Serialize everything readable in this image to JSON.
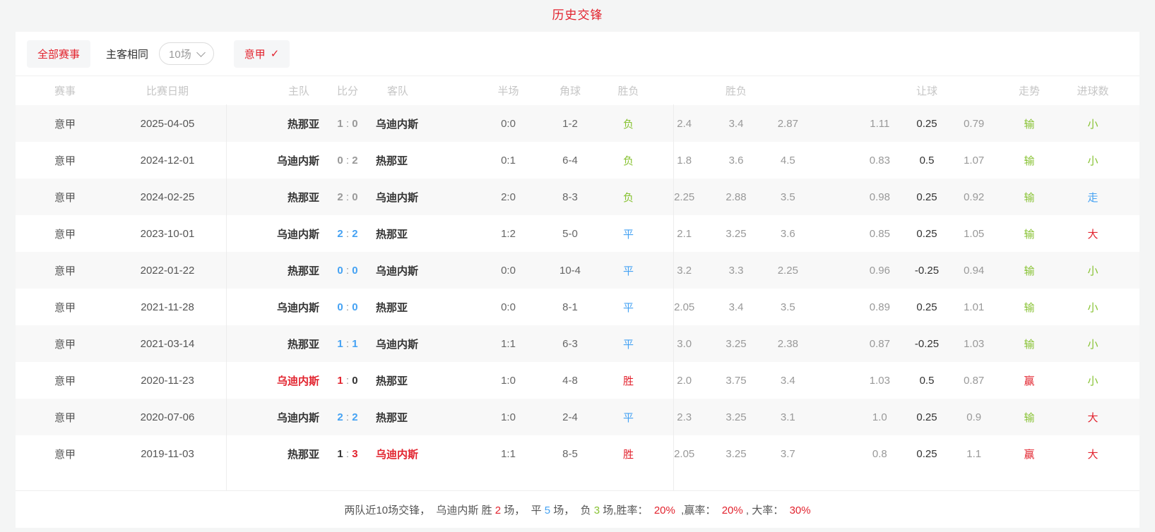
{
  "page": {
    "title": "历史交锋"
  },
  "colors": {
    "accent_red": "#e2232e",
    "win_red": "#e2232e",
    "draw_blue": "#45a2f3",
    "loss_green": "#87c232"
  },
  "filters": {
    "all_matches": "全部赛事",
    "same_home_away": "主客相同",
    "count_select": "10场",
    "league_filter": "意甲",
    "check": "✓"
  },
  "table": {
    "headers": {
      "league": "赛事",
      "date": "比赛日期",
      "home": "主队",
      "score": "比分",
      "away": "客队",
      "half": "半场",
      "corner": "角球",
      "result": "胜负",
      "odds_group": "胜负",
      "handicap_group": "让球",
      "trend": "走势",
      "goals": "进球数"
    },
    "score_sep": ":",
    "rows": [
      {
        "league": "意甲",
        "date": "2025-04-05",
        "home": "热那亚",
        "home_cls": "dark",
        "score_home": "1",
        "score_home_cls": "gray",
        "score_away": "0",
        "score_away_cls": "gray",
        "away": "乌迪内斯",
        "away_cls": "dark",
        "half": "0:0",
        "corner": "1-2",
        "result": "负",
        "result_cls": "green",
        "odds": [
          "2.4",
          "3.4",
          "2.87"
        ],
        "handicap": [
          "1.11",
          "0.25",
          "0.79"
        ],
        "trend": "输",
        "trend_cls": "green",
        "goals": "小",
        "goals_cls": "green"
      },
      {
        "league": "意甲",
        "date": "2024-12-01",
        "home": "乌迪内斯",
        "home_cls": "dark",
        "score_home": "0",
        "score_home_cls": "gray",
        "score_away": "2",
        "score_away_cls": "gray",
        "away": "热那亚",
        "away_cls": "dark",
        "half": "0:1",
        "corner": "6-4",
        "result": "负",
        "result_cls": "green",
        "odds": [
          "1.8",
          "3.6",
          "4.5"
        ],
        "handicap": [
          "0.83",
          "0.5",
          "1.07"
        ],
        "trend": "输",
        "trend_cls": "green",
        "goals": "小",
        "goals_cls": "green"
      },
      {
        "league": "意甲",
        "date": "2024-02-25",
        "home": "热那亚",
        "home_cls": "dark",
        "score_home": "2",
        "score_home_cls": "gray",
        "score_away": "0",
        "score_away_cls": "gray",
        "away": "乌迪内斯",
        "away_cls": "dark",
        "half": "2:0",
        "corner": "8-3",
        "result": "负",
        "result_cls": "green",
        "odds": [
          "2.25",
          "2.88",
          "3.5"
        ],
        "handicap": [
          "0.98",
          "0.25",
          "0.92"
        ],
        "trend": "输",
        "trend_cls": "green",
        "goals": "走",
        "goals_cls": "blue"
      },
      {
        "league": "意甲",
        "date": "2023-10-01",
        "home": "乌迪内斯",
        "home_cls": "dark",
        "score_home": "2",
        "score_home_cls": "blue",
        "score_away": "2",
        "score_away_cls": "blue",
        "away": "热那亚",
        "away_cls": "dark",
        "half": "1:2",
        "corner": "5-0",
        "result": "平",
        "result_cls": "blue",
        "odds": [
          "2.1",
          "3.25",
          "3.6"
        ],
        "handicap": [
          "0.85",
          "0.25",
          "1.05"
        ],
        "trend": "输",
        "trend_cls": "green",
        "goals": "大",
        "goals_cls": "red"
      },
      {
        "league": "意甲",
        "date": "2022-01-22",
        "home": "热那亚",
        "home_cls": "dark",
        "score_home": "0",
        "score_home_cls": "blue",
        "score_away": "0",
        "score_away_cls": "blue",
        "away": "乌迪内斯",
        "away_cls": "dark",
        "half": "0:0",
        "corner": "10-4",
        "result": "平",
        "result_cls": "blue",
        "odds": [
          "3.2",
          "3.3",
          "2.25"
        ],
        "handicap": [
          "0.96",
          "-0.25",
          "0.94"
        ],
        "trend": "输",
        "trend_cls": "green",
        "goals": "小",
        "goals_cls": "green"
      },
      {
        "league": "意甲",
        "date": "2021-11-28",
        "home": "乌迪内斯",
        "home_cls": "dark",
        "score_home": "0",
        "score_home_cls": "blue",
        "score_away": "0",
        "score_away_cls": "blue",
        "away": "热那亚",
        "away_cls": "dark",
        "half": "0:0",
        "corner": "8-1",
        "result": "平",
        "result_cls": "blue",
        "odds": [
          "2.05",
          "3.4",
          "3.5"
        ],
        "handicap": [
          "0.89",
          "0.25",
          "1.01"
        ],
        "trend": "输",
        "trend_cls": "green",
        "goals": "小",
        "goals_cls": "green"
      },
      {
        "league": "意甲",
        "date": "2021-03-14",
        "home": "热那亚",
        "home_cls": "dark",
        "score_home": "1",
        "score_home_cls": "blue",
        "score_away": "1",
        "score_away_cls": "blue",
        "away": "乌迪内斯",
        "away_cls": "dark",
        "half": "1:1",
        "corner": "6-3",
        "result": "平",
        "result_cls": "blue",
        "odds": [
          "3.0",
          "3.25",
          "2.38"
        ],
        "handicap": [
          "0.87",
          "-0.25",
          "1.03"
        ],
        "trend": "输",
        "trend_cls": "green",
        "goals": "小",
        "goals_cls": "green"
      },
      {
        "league": "意甲",
        "date": "2020-11-23",
        "home": "乌迪内斯",
        "home_cls": "red",
        "score_home": "1",
        "score_home_cls": "red",
        "score_away": "0",
        "score_away_cls": "dark",
        "away": "热那亚",
        "away_cls": "dark",
        "half": "1:0",
        "corner": "4-8",
        "result": "胜",
        "result_cls": "red",
        "odds": [
          "2.0",
          "3.75",
          "3.4"
        ],
        "handicap": [
          "1.03",
          "0.5",
          "0.87"
        ],
        "trend": "赢",
        "trend_cls": "red",
        "goals": "小",
        "goals_cls": "green"
      },
      {
        "league": "意甲",
        "date": "2020-07-06",
        "home": "乌迪内斯",
        "home_cls": "dark",
        "score_home": "2",
        "score_home_cls": "blue",
        "score_away": "2",
        "score_away_cls": "blue",
        "away": "热那亚",
        "away_cls": "dark",
        "half": "1:0",
        "corner": "2-4",
        "result": "平",
        "result_cls": "blue",
        "odds": [
          "2.3",
          "3.25",
          "3.1"
        ],
        "handicap": [
          "1.0",
          "0.25",
          "0.9"
        ],
        "trend": "输",
        "trend_cls": "green",
        "goals": "大",
        "goals_cls": "red"
      },
      {
        "league": "意甲",
        "date": "2019-11-03",
        "home": "热那亚",
        "home_cls": "dark",
        "score_home": "1",
        "score_home_cls": "dark",
        "score_away": "3",
        "score_away_cls": "red",
        "away": "乌迪内斯",
        "away_cls": "red",
        "half": "1:1",
        "corner": "8-5",
        "result": "胜",
        "result_cls": "red",
        "odds": [
          "2.05",
          "3.25",
          "3.7"
        ],
        "handicap": [
          "0.8",
          "0.25",
          "1.1"
        ],
        "trend": "赢",
        "trend_cls": "red",
        "goals": "大",
        "goals_cls": "red"
      }
    ]
  },
  "footer": {
    "segments": [
      {
        "text": "两队近10场交锋，  乌迪内斯 胜 ",
        "cls": "mid"
      },
      {
        "text": "2",
        "cls": "red"
      },
      {
        "text": " 场，  平 ",
        "cls": "mid"
      },
      {
        "text": "5",
        "cls": "blue"
      },
      {
        "text": " 场，  负 ",
        "cls": "mid"
      },
      {
        "text": "3",
        "cls": "green"
      },
      {
        "text": " 场,胜率：  ",
        "cls": "mid"
      },
      {
        "text": "20%",
        "cls": "red"
      },
      {
        "text": "  ,赢率：  ",
        "cls": "mid"
      },
      {
        "text": "20%",
        "cls": "red"
      },
      {
        "text": " , 大率：  ",
        "cls": "mid"
      },
      {
        "text": "30%",
        "cls": "red"
      }
    ]
  }
}
